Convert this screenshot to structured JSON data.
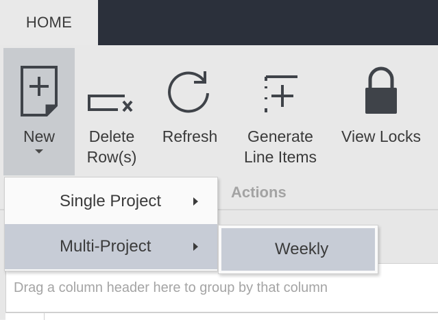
{
  "tabs": {
    "home": "HOME"
  },
  "ribbon": {
    "new": {
      "label": "New",
      "icon": "new-document-icon"
    },
    "delete_rows": {
      "line1": "Delete",
      "line2": "Row(s)",
      "icon": "delete-row-icon"
    },
    "refresh": {
      "label": "Refresh",
      "icon": "refresh-icon"
    },
    "generate": {
      "line1": "Generate",
      "line2": "Line Items",
      "icon": "generate-line-items-icon"
    },
    "view_locks": {
      "label": "View Locks",
      "icon": "lock-icon"
    },
    "group_label": "Actions"
  },
  "menu": {
    "items": [
      {
        "label": "Single Project"
      },
      {
        "label": "Multi-Project"
      }
    ],
    "submenu": [
      {
        "label": "Weekly"
      }
    ]
  },
  "grid": {
    "group_panel_text": "Drag a column header here to group by that column"
  },
  "colors": {
    "topbar": "#2b303b",
    "ribbon_bg": "#e8e8e8",
    "pressed_button": "#c8cbcf",
    "menu_highlight": "#c7ccd6",
    "icon_color": "#3f4349"
  }
}
